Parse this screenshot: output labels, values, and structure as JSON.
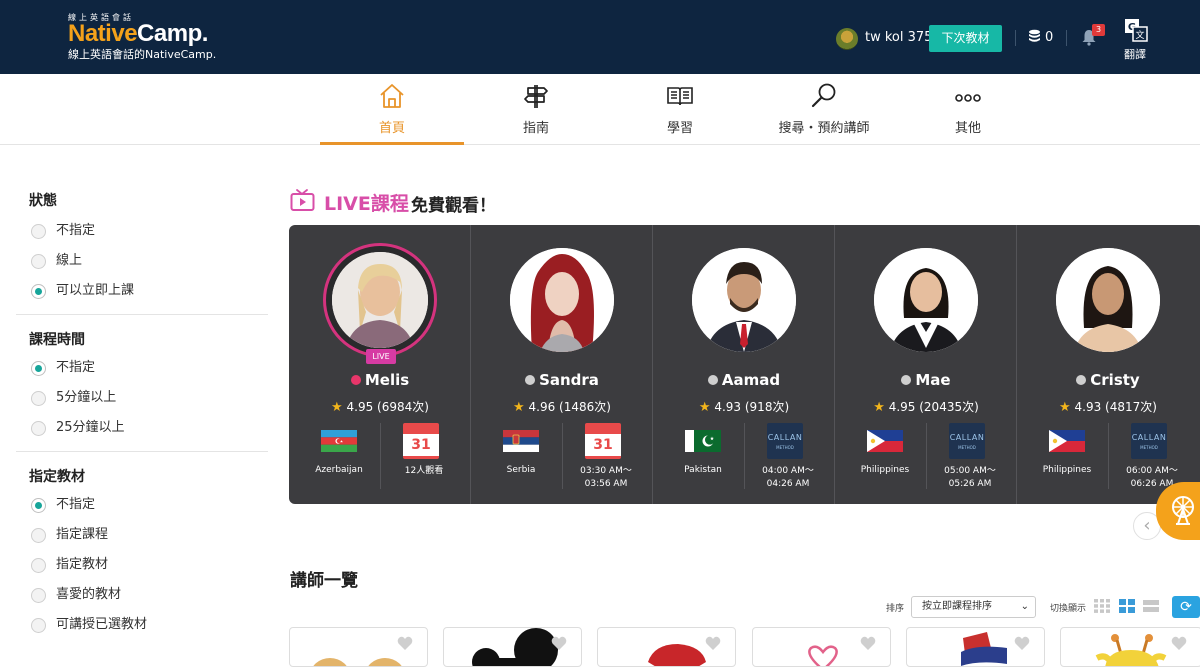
{
  "header": {
    "logo_tiny": "線上英語會話",
    "logo_name_a": "Native",
    "logo_name_b": "Camp.",
    "logo_tagline": "線上英語會話的NativeCamp.",
    "username": "tw kol 375",
    "next_material_label": "下次教材",
    "coin_count": "0",
    "notification_count": "3",
    "translate_label": "翻譯"
  },
  "nav": {
    "items": [
      {
        "label": "首頁",
        "icon": "home-icon",
        "active": true
      },
      {
        "label": "指南",
        "icon": "signpost-icon",
        "active": false
      },
      {
        "label": "學習",
        "icon": "book-icon",
        "active": false
      },
      {
        "label": "搜尋・預約講師",
        "icon": "search-icon",
        "active": false
      },
      {
        "label": "其他",
        "icon": "more-icon",
        "active": false
      }
    ]
  },
  "sidebar": {
    "sections": [
      {
        "title": "狀態",
        "options": [
          {
            "label": "不指定",
            "checked": false
          },
          {
            "label": "線上",
            "checked": false
          },
          {
            "label": "可以立即上課",
            "checked": true
          }
        ]
      },
      {
        "title": "課程時間",
        "options": [
          {
            "label": "不指定",
            "checked": true
          },
          {
            "label": "5分鐘以上",
            "checked": false
          },
          {
            "label": "25分鐘以上",
            "checked": false
          }
        ]
      },
      {
        "title": "指定教材",
        "options": [
          {
            "label": "不指定",
            "checked": true
          },
          {
            "label": "指定課程",
            "checked": false
          },
          {
            "label": "指定教材",
            "checked": false
          },
          {
            "label": "喜愛的教材",
            "checked": false
          },
          {
            "label": "可講授已選教材",
            "checked": false
          }
        ]
      }
    ]
  },
  "live": {
    "title_a": "LIVE課程",
    "title_b": "免費觀看！",
    "live_badge": "LIVE",
    "cards": [
      {
        "name": "Melis",
        "status": "live",
        "rating": "4.95 (6984次)",
        "country": "Azerbaijan",
        "flag": "azerbaijan-flag",
        "right_type": "calendar",
        "cal_num": "31",
        "right_text": "12人觀看"
      },
      {
        "name": "Sandra",
        "status": "offline",
        "rating": "4.96 (1486次)",
        "country": "Serbia",
        "flag": "serbia-flag",
        "right_type": "calendar",
        "cal_num": "31",
        "right_text": "03:30 AM〜\n03:56 AM"
      },
      {
        "name": "Aamad",
        "status": "offline",
        "rating": "4.93 (918次)",
        "country": "Pakistan",
        "flag": "pakistan-flag",
        "right_type": "method",
        "method_text": "CALLAN",
        "method_sub": "METHOD",
        "right_text": "04:00 AM〜\n04:26 AM"
      },
      {
        "name": "Mae",
        "status": "offline",
        "rating": "4.95 (20435次)",
        "country": "Philippines",
        "flag": "philippines-flag",
        "right_type": "method",
        "method_text": "CALLAN",
        "method_sub": "METHOD",
        "right_text": "05:00 AM〜\n05:26 AM"
      },
      {
        "name": "Cristy",
        "status": "offline",
        "rating": "4.93 (4817次)",
        "country": "Philippines",
        "flag": "philippines-flag",
        "right_type": "method",
        "method_text": "CALLAN",
        "method_sub": "METHOD",
        "right_text": "06:00 AM〜\n06:26 AM"
      }
    ]
  },
  "teacher_list": {
    "title": "講師一覽",
    "sort_label": "排序",
    "sort_value": "按立即課程排序",
    "toggle_label": "切換顯示"
  },
  "colors": {
    "header_bg": "#0e2540",
    "accent_orange": "#e8942a",
    "teal": "#17b8a6",
    "live_pink": "#d84ea8",
    "panel_bg": "#3c3c3f"
  }
}
